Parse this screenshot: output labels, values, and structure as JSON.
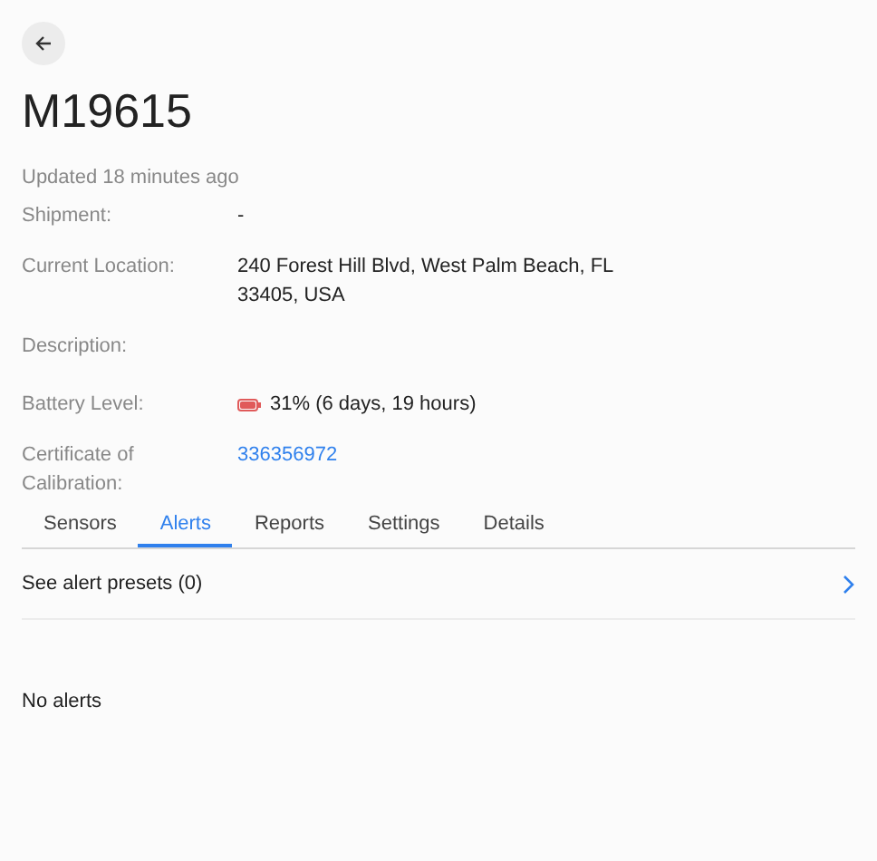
{
  "title": "M19615",
  "updated": "Updated 18 minutes ago",
  "fields": [
    {
      "label": "Shipment:",
      "kind": "text",
      "value": "-"
    },
    {
      "label": "Current Location:",
      "kind": "text",
      "value": "240 Forest Hill Blvd, West Palm Beach, FL 33405, USA"
    },
    {
      "label": "Description:",
      "kind": "empty"
    },
    {
      "label": "Battery Level:",
      "kind": "battery",
      "value": "31% (6 days, 19 hours)"
    },
    {
      "label": "Certificate of Calibration:",
      "kind": "link",
      "value": "336356972"
    }
  ],
  "tabs": [
    {
      "label": "Sensors",
      "selected": false
    },
    {
      "label": "Alerts",
      "selected": true
    },
    {
      "label": "Reports",
      "selected": false
    },
    {
      "label": "Settings",
      "selected": false
    },
    {
      "label": "Details",
      "selected": false
    }
  ],
  "presets_link": "See alert presets (0)",
  "empty_message": "No alerts"
}
